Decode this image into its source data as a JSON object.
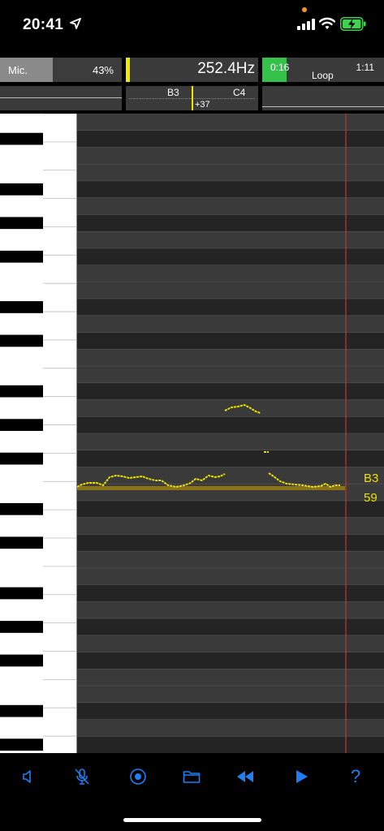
{
  "status_bar": {
    "time": "20:41",
    "icons": [
      "location-arrow-icon",
      "privacy-dot-icon",
      "signal-bars-icon",
      "wifi-icon",
      "battery-charging-icon"
    ]
  },
  "mic": {
    "label": "Mic.",
    "level_text": "43%",
    "level": 0.43
  },
  "frequency": {
    "value": "252.4Hz"
  },
  "timeline": {
    "current": "0:16",
    "total": "1:11",
    "mode": "Loop",
    "progress": 0.2
  },
  "tuner": {
    "lower_note": "B3",
    "upper_note": "C4",
    "cents": "+37"
  },
  "piano_roll": {
    "current_note": {
      "name": "B3",
      "number": "59"
    }
  },
  "toolbar": {
    "buttons": [
      {
        "name": "speaker-button",
        "icon": "speaker-icon"
      },
      {
        "name": "mic-mute-button",
        "icon": "mic-slash-icon"
      },
      {
        "name": "record-button",
        "icon": "record-circle-icon"
      },
      {
        "name": "folder-button",
        "icon": "folder-icon"
      },
      {
        "name": "rewind-button",
        "icon": "rewind-icon"
      },
      {
        "name": "play-button",
        "icon": "play-icon"
      },
      {
        "name": "help-button",
        "icon": "question-mark-icon",
        "label": "?"
      }
    ]
  },
  "colors": {
    "pitch_line": "#e9e000",
    "playhead": "#c0392b",
    "accent_blue": "#1f7ff2",
    "timeline_green": "#35c24a",
    "target_note_band": "#8a7416"
  }
}
